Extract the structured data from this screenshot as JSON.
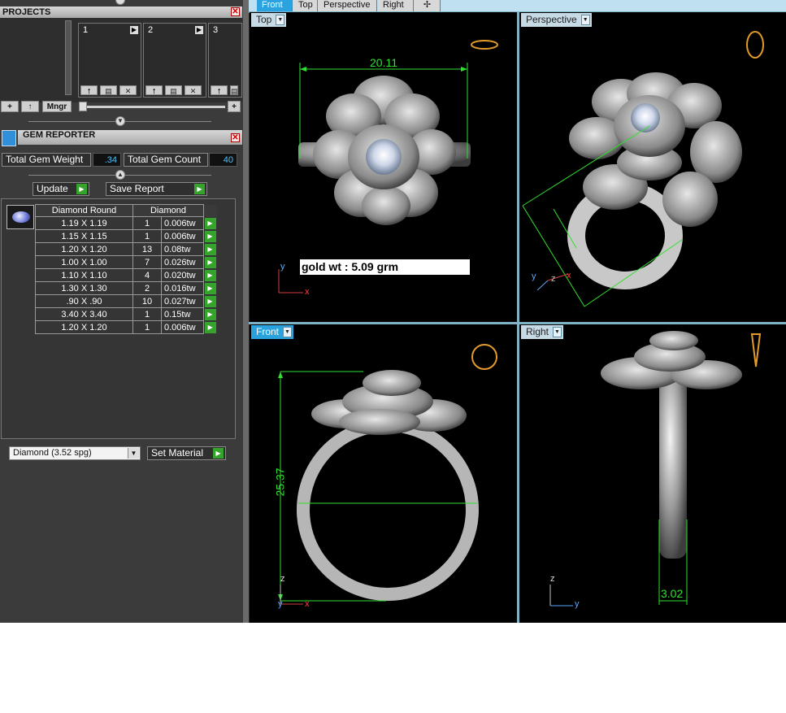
{
  "projects": {
    "title": "PROJECTS",
    "slots": [
      {
        "num": "1"
      },
      {
        "num": "2"
      },
      {
        "num": "3"
      }
    ],
    "toolbar": {
      "add": "+",
      "up": "↑",
      "mngr": "Mngr",
      "plus": "+"
    }
  },
  "gem_reporter": {
    "title": "GEM REPORTER",
    "total_weight_label": "Total Gem Weight",
    "total_weight_value": ".34",
    "total_count_label": "Total Gem Count",
    "total_count_value": "40",
    "update_label": "Update",
    "save_report_label": "Save Report",
    "table": {
      "col1": "Diamond Round",
      "col2": "Diamond",
      "rows": [
        {
          "size": "1.19 X 1.19",
          "qty": "1",
          "wt": "0.006tw"
        },
        {
          "size": "1.15 X 1.15",
          "qty": "1",
          "wt": "0.006tw"
        },
        {
          "size": "1.20 X 1.20",
          "qty": "13",
          "wt": "0.08tw"
        },
        {
          "size": "1.00 X 1.00",
          "qty": "7",
          "wt": "0.026tw"
        },
        {
          "size": "1.10 X 1.10",
          "qty": "4",
          "wt": "0.020tw"
        },
        {
          "size": "1.30 X 1.30",
          "qty": "2",
          "wt": "0.016tw"
        },
        {
          "size": ".90 X .90",
          "qty": "10",
          "wt": "0.027tw"
        },
        {
          "size": "3.40 X 3.40",
          "qty": "1",
          "wt": "0.15tw"
        },
        {
          "size": "1.20 X 1.20",
          "qty": "1",
          "wt": "0.006tw"
        }
      ]
    },
    "material_select": "Diamond    (3.52 spg)",
    "set_material_label": "Set Material"
  },
  "tabs": [
    {
      "label": "Front"
    },
    {
      "label": "Top"
    },
    {
      "label": "Perspective"
    },
    {
      "label": "Right"
    }
  ],
  "viewports": {
    "top": {
      "label": "Top",
      "dimension": "20.11",
      "note": "gold wt : 5.09 grm",
      "axis_v": "y",
      "axis_h": "x"
    },
    "perspective": {
      "label": "Perspective",
      "axis_y": "y",
      "axis_z": "z",
      "axis_x": "x"
    },
    "front": {
      "label": "Front",
      "dimension": "25.37",
      "axis_v": "z",
      "axis_h": "x",
      "axis_o": "y"
    },
    "right": {
      "label": "Right",
      "dimension": "3.02",
      "axis_v": "z",
      "axis_h": "y"
    }
  },
  "colors": {
    "accent": "#29a2de",
    "go": "#36a32c",
    "dim": "#2fe12f"
  }
}
